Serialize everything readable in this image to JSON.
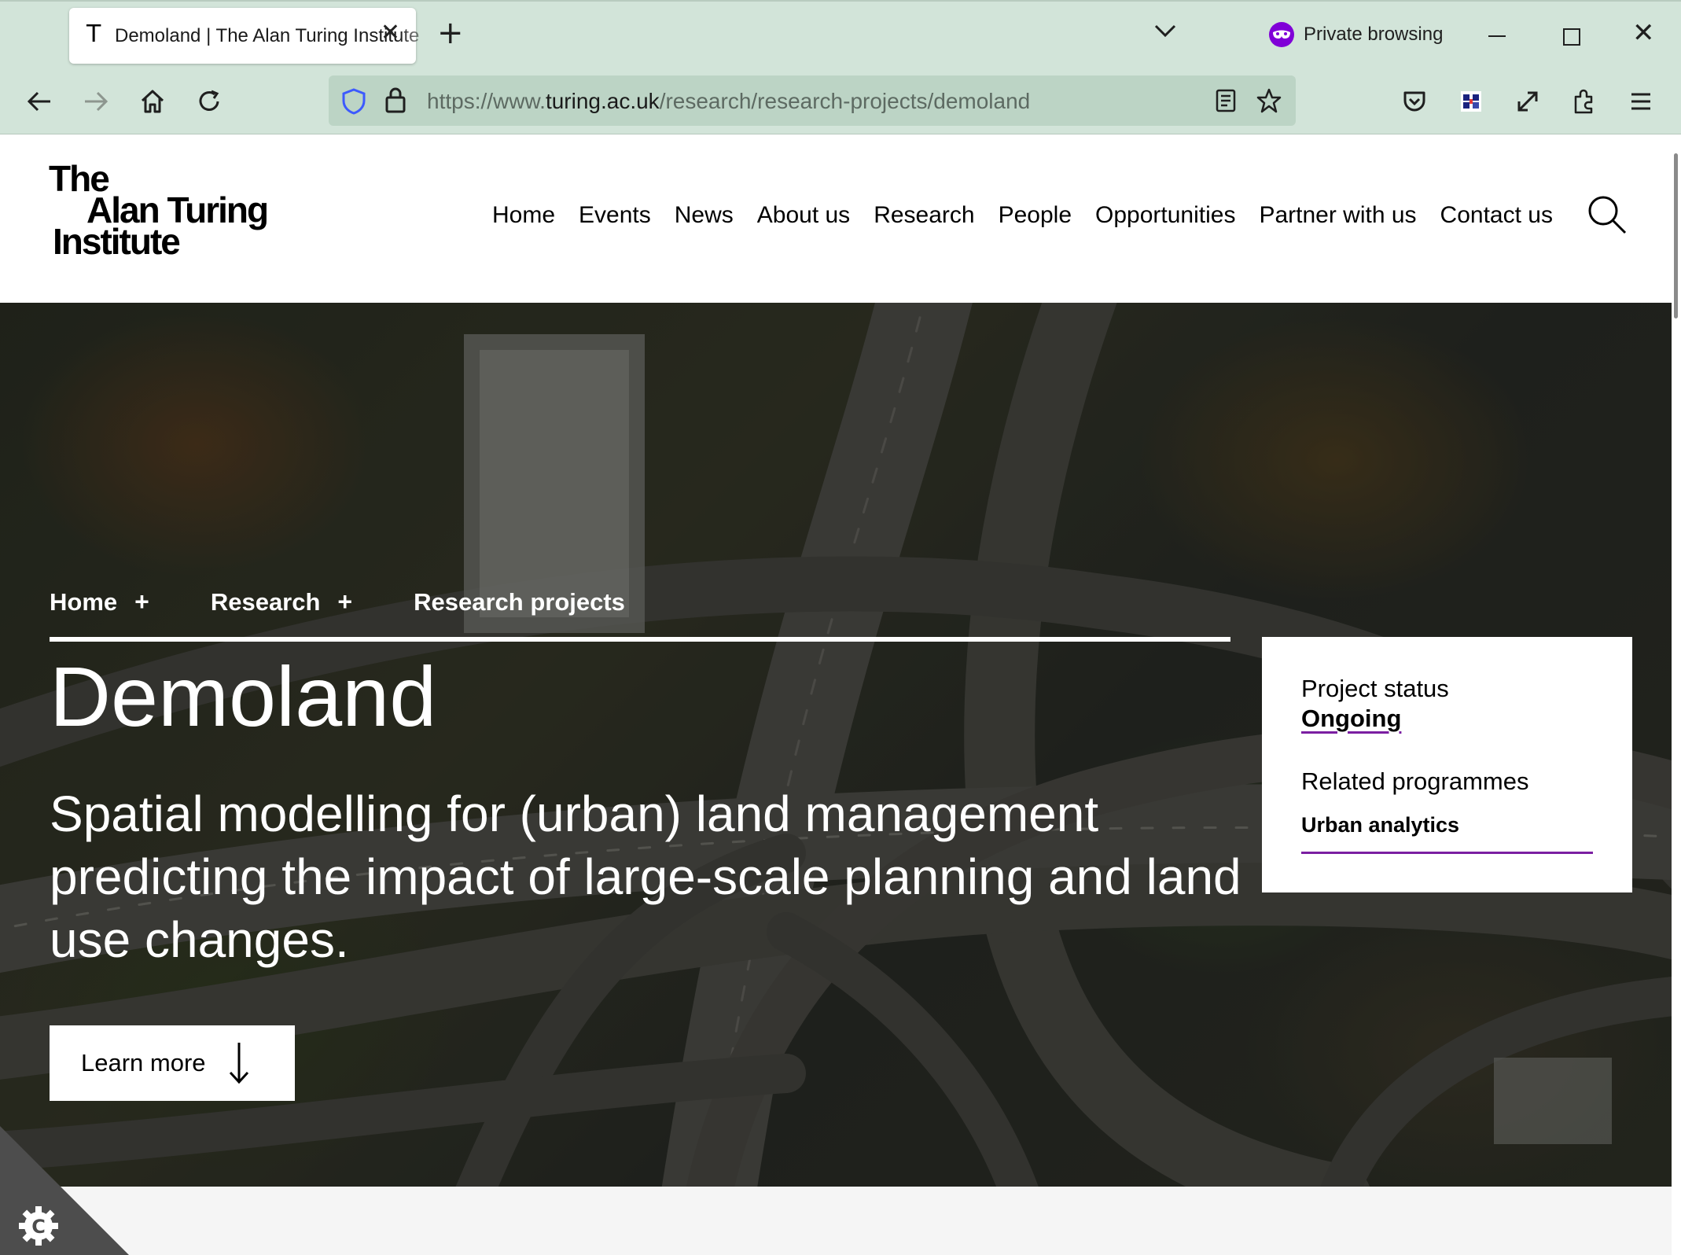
{
  "browser": {
    "tab_title": "Demoland | The Alan Turing Institute",
    "tab_favicon": "T",
    "private_label": "Private browsing",
    "url_prefix": "https://www.",
    "url_domain": "turing.ac.uk",
    "url_path": "/research/research-projects/demoland",
    "icons": [
      "back-icon",
      "forward-icon",
      "home-icon",
      "reload-icon",
      "shield-icon",
      "lock-icon",
      "reader-view-icon",
      "bookmark-star-icon",
      "pocket-icon",
      "extension-badge-icon",
      "fullscreen-icon",
      "extensions-icon",
      "menu-icon"
    ]
  },
  "site": {
    "logo_lines": [
      "The",
      "Alan Turing",
      "Institute"
    ],
    "nav": [
      "Home",
      "Events",
      "News",
      "About us",
      "Research",
      "People",
      "Opportunities",
      "Partner with us",
      "Contact us"
    ]
  },
  "hero": {
    "breadcrumb": [
      "Home",
      "Research",
      "Research projects"
    ],
    "breadcrumb_sep": "+",
    "title": "Demoland",
    "subtitle": "Spatial modelling for (urban) land management predicting the impact of large-scale planning and land use changes.",
    "cta": "Learn more"
  },
  "status_card": {
    "status_label": "Project status",
    "status_value": "Ongoing",
    "related_label": "Related programmes",
    "programme": "Urban analytics"
  },
  "colors": {
    "chrome_bg": "#d2e4d9",
    "urlbar_bg": "#bcd4c5",
    "accent_purple": "#7b1fa2",
    "private_purple": "#8000d7"
  }
}
